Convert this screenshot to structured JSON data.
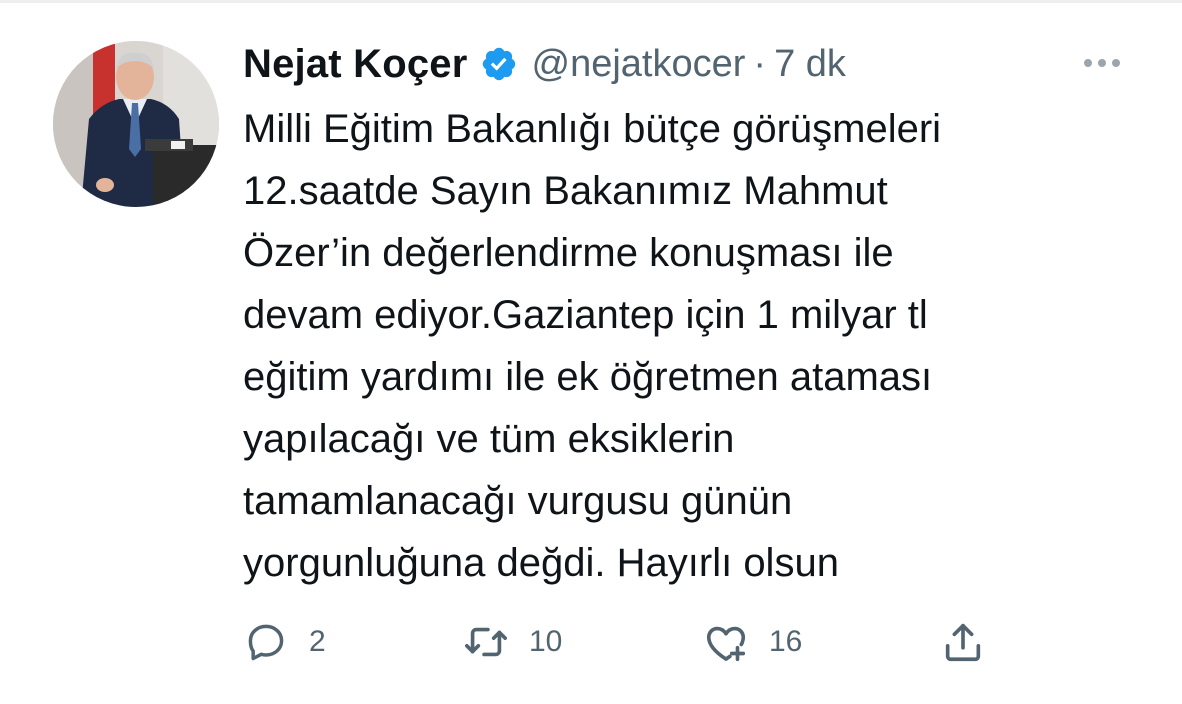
{
  "tweet": {
    "author_name": "Nejat Koçer",
    "handle": "@nejatkocer",
    "separator": "·",
    "time": "7 dk",
    "text_lines": [
      "Milli Eğitim Bakanlığı bütçe görüşmeleri",
      "12.saatde Sayın Bakanımız Mahmut",
      "Özer’in değerlendirme konuşması ile",
      "devam ediyor.Gaziantep için 1 milyar tl",
      "eğitim yardımı ile ek öğretmen ataması",
      "yapılacağı ve tüm eksiklerin",
      "tamamlanacağı vurgusu günün",
      "yorgunluğuna değdi. Hayırlı olsun"
    ],
    "actions": {
      "reply_count": "2",
      "retweet_count": "10",
      "like_count": "16"
    }
  },
  "icons": {
    "verified": "verified-badge-icon",
    "more": "more-icon",
    "reply": "reply-icon",
    "retweet": "retweet-icon",
    "like": "like-icon",
    "share": "share-icon"
  },
  "colors": {
    "verified": "#1d9bf0",
    "text": "#0f1419",
    "secondary": "#536471"
  }
}
